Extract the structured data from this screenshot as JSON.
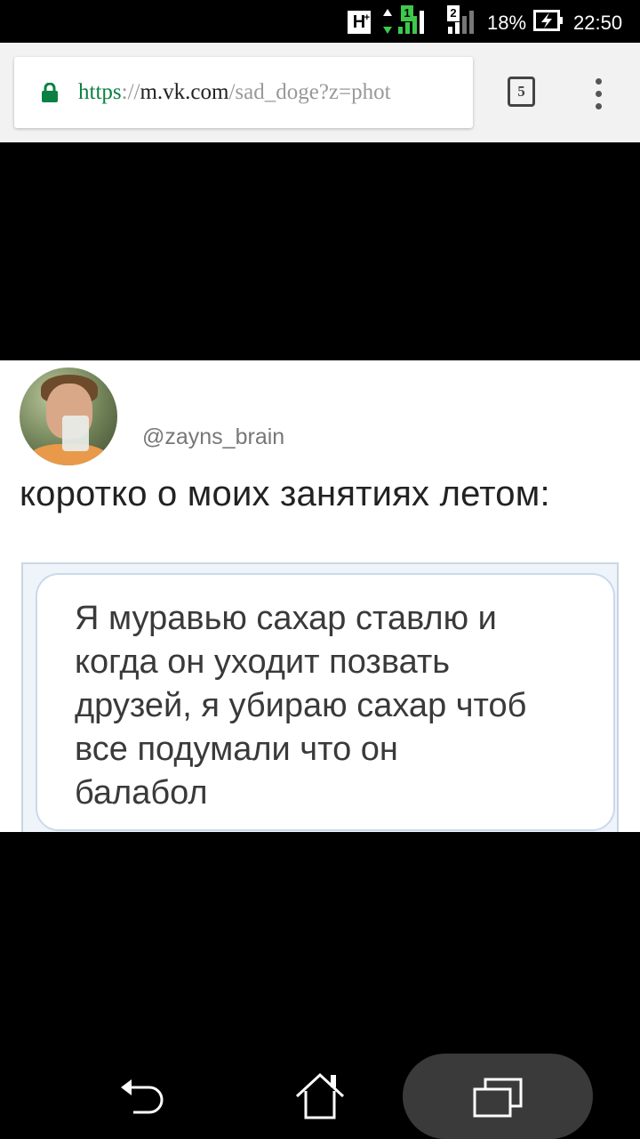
{
  "status_bar": {
    "network_type": "H",
    "network_type_sup": "+",
    "sim1_label": "1",
    "sim2_label": "2",
    "battery_percent": "18%",
    "time": "22:50",
    "colors": {
      "sim1": "#3ec94a"
    }
  },
  "browser": {
    "url_scheme": "https",
    "url_sep": "://",
    "url_host": "m.vk.com",
    "url_path": "/sad_doge?z=phot",
    "tab_count": "5",
    "icons": [
      "lock-icon",
      "tabs-icon",
      "overflow-menu-icon"
    ]
  },
  "post": {
    "handle": "@zayns_brain",
    "tweet_text": "коротко о моих занятиях летом:",
    "bubble_lines": [
      "Я муравью сахар ставлю и",
      "когда он уходит позвать",
      "друзей,  я убираю сахар чтоб",
      "все подумали что он",
      "балабол"
    ]
  },
  "nav_bar": {
    "icons": [
      "back-icon",
      "home-icon",
      "recents-icon"
    ]
  }
}
